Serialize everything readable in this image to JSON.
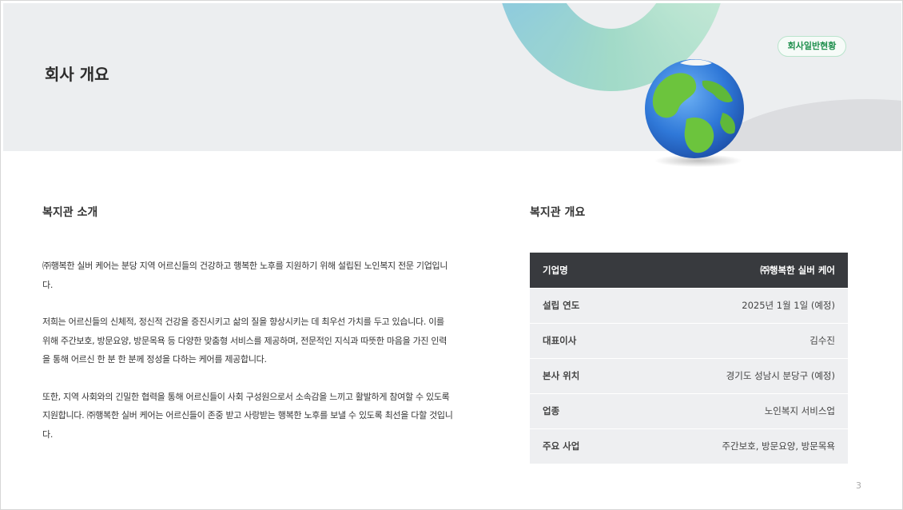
{
  "banner": {
    "title": "회사 개요",
    "badge": "회사일반현황"
  },
  "intro": {
    "heading": "복지관 소개",
    "paragraphs": [
      "㈜행복한 실버 케어는 분당 지역 어르신들의 건강하고 행복한 노후를 지원하기 위해 설립된 노인복지 전문 기업입니다.",
      "저희는 어르신들의 신체적, 정신적 건강을 증진시키고 삶의 질을 향상시키는 데 최우선 가치를 두고 있습니다. 이를 위해 주간보호, 방문요양, 방문목욕 등 다양한 맞춤형 서비스를 제공하며, 전문적인 지식과 따뜻한 마음을 가진 인력을 통해 어르신 한 분 한 분께 정성을 다하는 케어를 제공합니다.",
      "또한, 지역 사회와의 긴밀한 협력을 통해 어르신들이 사회 구성원으로서 소속감을 느끼고 활발하게 참여할 수 있도록 지원합니다. ㈜행복한 실버 케어는 어르신들이 존중 받고 사랑받는 행복한 노후를 보낼 수 있도록 최선을 다할 것입니다."
    ]
  },
  "overview": {
    "heading": "복지관 개요",
    "rows": [
      {
        "label": "기업명",
        "value": "㈜행복한 실버 케어"
      },
      {
        "label": "설립 연도",
        "value": "2025년 1월 1일 (예정)"
      },
      {
        "label": "대표이사",
        "value": "김수진"
      },
      {
        "label": "본사 위치",
        "value": "경기도 성남시 분당구 (예정)"
      },
      {
        "label": "업종",
        "value": "노인복지 서비스업"
      },
      {
        "label": "주요 사업",
        "value": "주간보호, 방문요양, 방문목욕"
      }
    ]
  },
  "page_number": "3",
  "icons": {
    "globe": "globe-icon"
  },
  "colors": {
    "badge_text": "#1f8f4d",
    "table_header": "#383a3e",
    "table_row": "#eeeff1"
  }
}
